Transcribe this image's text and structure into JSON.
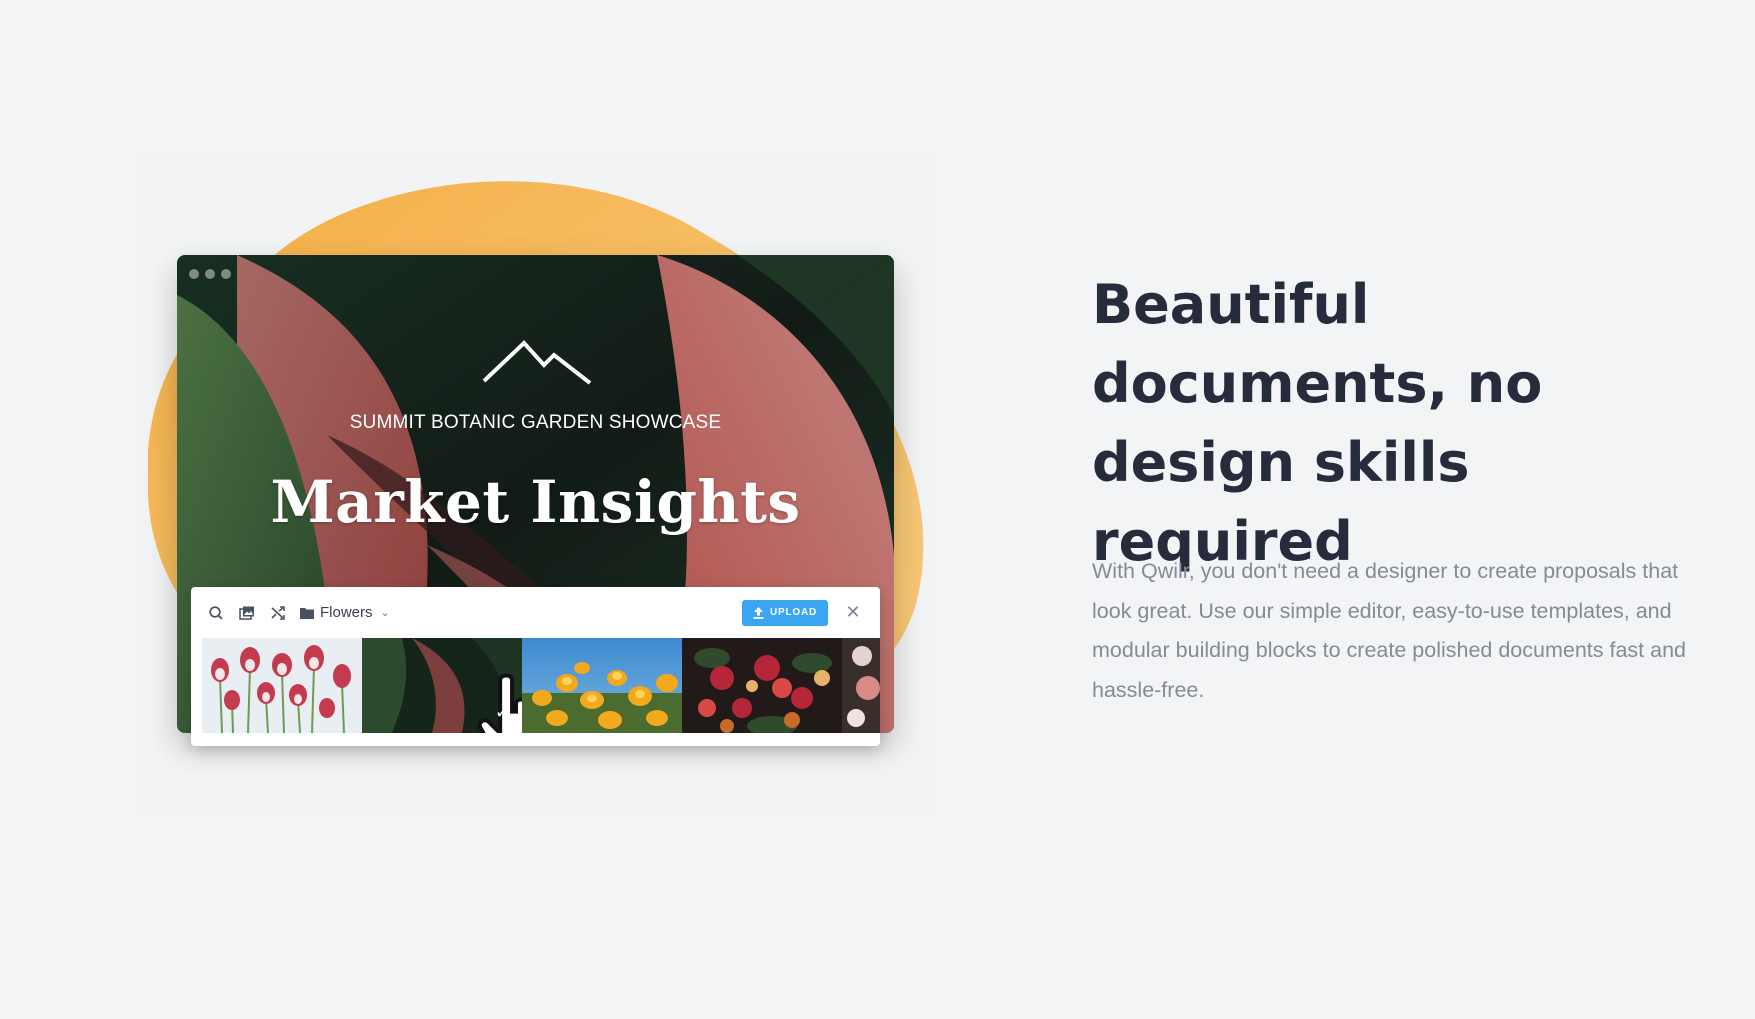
{
  "illustration": {
    "window": {
      "subtitle": "SUMMIT BOTANIC GARDEN SHOWCASE",
      "headline": "Market Insights"
    },
    "picker": {
      "folder_label": "Flowers",
      "upload_label": "UPLOAD",
      "close_symbol": "✕",
      "check_symbol": "✓"
    }
  },
  "feature": {
    "title": "Beautiful documents, no design skills required",
    "body": "With Qwilr, you don't need a designer to create proposals that look great. Use our simple editor, easy-to-use templates, and modular building blocks to create polished documents fast and hassle-free."
  },
  "icons": {
    "search": "search-icon",
    "gallery": "image-library-icon",
    "shuffle": "shuffle-icon",
    "folder": "folder-icon",
    "upload": "upload-icon",
    "close": "close-icon",
    "check": "checkmark-icon",
    "cursor": "hand-pointer-icon",
    "logo": "mountain-logo"
  },
  "colors": {
    "background": "#f3f4f6",
    "blob": "#f5b95a",
    "upload_button": "#3aa6f2",
    "title": "#262c3c",
    "body": "#858a96"
  }
}
